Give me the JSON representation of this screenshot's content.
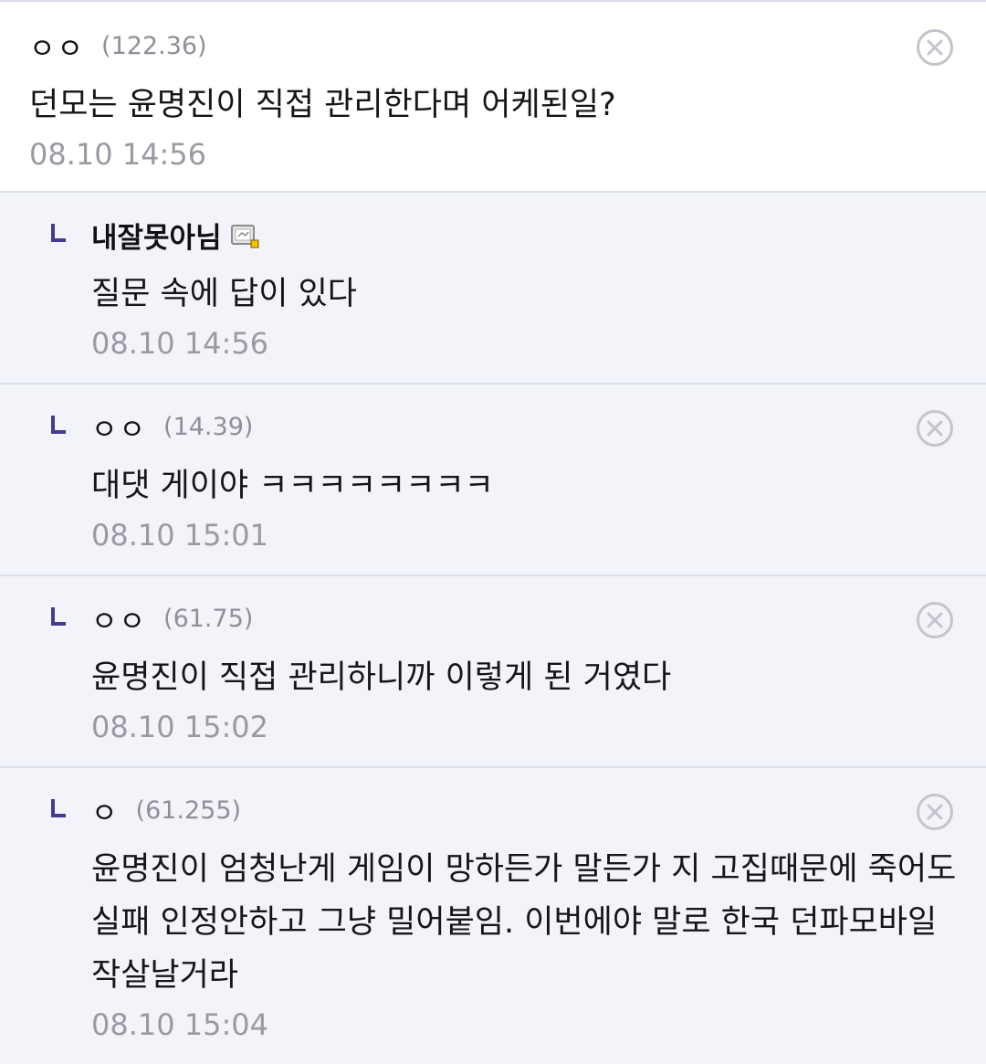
{
  "comments": [
    {
      "nick": "ㅇㅇ",
      "ip": "(122.36)",
      "text": "던모는 윤명진이 직접 관리한다며 어케된일?",
      "time": "08.10 14:56"
    },
    {
      "nick": "내잘못아님",
      "icon": "gallog-icon",
      "text": "질문 속에 답이 있다",
      "time": "08.10 14:56"
    },
    {
      "nick": "ㅇㅇ",
      "ip": "(14.39)",
      "text": "대댓 게이야 ㅋㅋㅋㅋㅋㅋㅋㅋ",
      "time": "08.10 15:01"
    },
    {
      "nick": "ㅇㅇ",
      "ip": "(61.75)",
      "text": "윤명진이 직접 관리하니까 이렇게 된 거였다",
      "time": "08.10 15:02"
    },
    {
      "nick": "ㅇ",
      "ip": "(61.255)",
      "text": "윤명진이 엄청난게 게임이 망하든가 말든가 지 고집때문에 죽어도 실패 인정안하고 그냥 밀어붙임. 이번에야 말로 한국 던파모바일 작살날거라",
      "time": "08.10 15:04"
    }
  ],
  "colors": {
    "reply_bg": "#f3f4f9",
    "reply_mark": "#3f3d8c",
    "meta_gray": "#9a9aa3"
  }
}
